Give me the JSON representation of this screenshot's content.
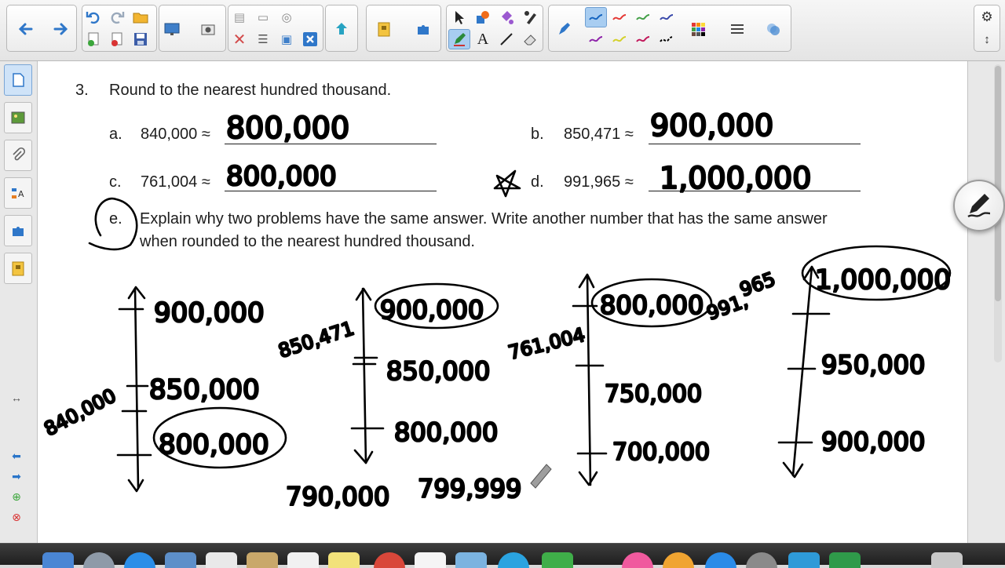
{
  "toolbar": {
    "back_icon": "arrow-left-icon",
    "forward_icon": "arrow-right-icon",
    "undo_icon": "undo-icon",
    "redo_icon": "redo-icon",
    "open_icon": "folder-icon",
    "save_icon": "save-icon",
    "pen_colors": [
      "#1565c0",
      "#e53935",
      "#43a047",
      "#3949ab",
      "#8e24aa",
      "#d4d12a",
      "#c2185b",
      "#000000"
    ],
    "palette_icon": "color-grid-icon",
    "line_style_icon": "line-style-icon",
    "settings_icon": "gear-icon"
  },
  "sidebar": {
    "tabs": [
      "page-sorter-icon",
      "gallery-icon",
      "attachments-icon",
      "properties-icon",
      "addons-icon",
      "lesson-activity-icon"
    ]
  },
  "page": {
    "question_number": "3.",
    "question_text": "Round to the nearest hundred thousand.",
    "items": [
      {
        "letter": "a.",
        "value": "840,000 ≈",
        "answer": "800,000"
      },
      {
        "letter": "b.",
        "value": "850,471 ≈",
        "answer": "900,000"
      },
      {
        "letter": "c.",
        "value": "761,004 ≈",
        "answer": "800,000"
      },
      {
        "letter": "d.",
        "value": "991,965 ≈",
        "answer": "1,000,000"
      }
    ],
    "part_e_letter": "e.",
    "part_e_line1": "Explain why two problems have the same answer.  Write another number that has the same answer",
    "part_e_line2": "when rounded to the nearest hundred thousand.",
    "ink_labels": {
      "line1": {
        "top": "900,000",
        "mid": "850,000",
        "bottom": "800,000",
        "side": "840,000"
      },
      "line2": {
        "top": "900,000",
        "mid": "850,000",
        "bottom": "800,000",
        "side": "850,471",
        "below1": "790,000",
        "below2": "799,999"
      },
      "line3": {
        "top": "800,000",
        "mid": "750,000",
        "bottom": "700,000",
        "side": "761,004"
      },
      "line4": {
        "top": "1,000,000",
        "mid": "950,000",
        "bottom": "900,000",
        "side_a": "991,",
        "side_b": "965"
      }
    }
  }
}
